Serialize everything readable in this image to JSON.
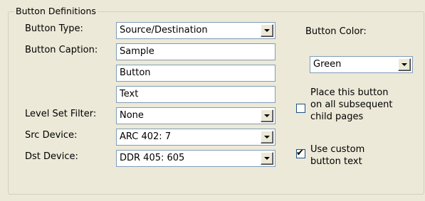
{
  "group": {
    "title": "Button Definitions"
  },
  "labels": {
    "button_type": "Button Type:",
    "button_caption": "Button Caption:",
    "level_set_filter": "Level Set Filter:",
    "src_device": "Src Device:",
    "dst_device": "Dst Device:",
    "button_color": "Button Color:"
  },
  "fields": {
    "button_type": "Source/Destination",
    "caption_line_1": "Sample",
    "caption_line_2": "Button",
    "caption_line_3": "Text",
    "level_set_filter": "None",
    "src_device": "ARC 402: 7",
    "dst_device": "DDR 405: 605",
    "button_color": "Green"
  },
  "checkboxes": {
    "place_on_child_pages": {
      "checked": false,
      "label_lines": [
        "Place this button",
        "on all subsequent",
        "child pages"
      ]
    },
    "use_custom_text": {
      "checked": true,
      "mark": "✔",
      "label_lines": [
        "Use custom",
        "button text"
      ]
    }
  },
  "colors": {
    "background": "#ece9d8",
    "field_border": "#7f9db9",
    "group_border": "#d0d0bf"
  }
}
